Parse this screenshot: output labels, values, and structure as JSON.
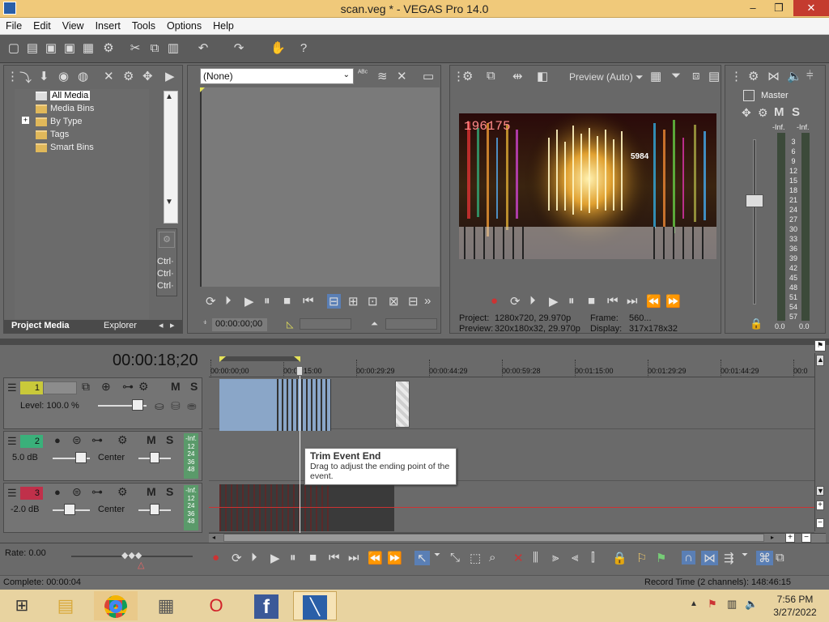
{
  "window": {
    "title": "scan.veg * - VEGAS Pro 14.0",
    "min": "‒",
    "max": "❐",
    "close": "✕"
  },
  "menu": [
    "File",
    "Edit",
    "View",
    "Insert",
    "Tools",
    "Options",
    "Help"
  ],
  "media_panel": {
    "tree": [
      "All Media",
      "Media Bins",
      "By Type",
      "Tags",
      "Smart Bins"
    ],
    "expand": "+",
    "ctrl": [
      "Ctrl·",
      "Ctrl·",
      "Ctrl·"
    ],
    "tabs": {
      "active": "Project Media",
      "other": "Explorer"
    }
  },
  "trimmer": {
    "dropdown": "(None)",
    "timecode": "00:00:00;00"
  },
  "preview": {
    "mode": "Preview (Auto)",
    "project_label": "Project:",
    "project_value": "1280x720, 29.970p",
    "preview_label": "Preview:",
    "preview_value": "320x180x32, 29.970p",
    "frame_label": "Frame:",
    "frame_value": "560...",
    "display_label": "Display:",
    "display_value": "317x178x32",
    "video_text_left": "196175",
    "video_text_num": "5984"
  },
  "master": {
    "label": "Master",
    "m": "M",
    "s": "S",
    "inf": [
      "-Inf.",
      "-Inf."
    ],
    "scale": [
      "3",
      "6",
      "9",
      "12",
      "15",
      "18",
      "21",
      "24",
      "27",
      "30",
      "33",
      "36",
      "39",
      "42",
      "45",
      "48",
      "51",
      "54",
      "57"
    ],
    "bottom": [
      "0.0",
      "0.0"
    ]
  },
  "timeline": {
    "timecode": "00:00:18;20",
    "ruler": [
      "00:00:00;00",
      "00:00:15:00",
      "00:00:29:29",
      "00:00:44:29",
      "00:00:59:28",
      "00:01:15:00",
      "00:01:29:29",
      "00:01:44:29",
      "00:0"
    ],
    "tracks": [
      {
        "num": "1",
        "level": "Level: 100.0 %",
        "color": "#c9c93a"
      },
      {
        "num": "2",
        "level": "5.0 dB",
        "pan": "Center",
        "color": "#3ab07a",
        "meter": [
          "-Inf.",
          "12",
          "24",
          "36",
          "48"
        ]
      },
      {
        "num": "3",
        "level": "-2.0 dB",
        "pan": "Center",
        "color": "#c0304a",
        "meter": [
          "-Inf.",
          "12",
          "24",
          "36",
          "48"
        ]
      }
    ],
    "m": "M",
    "s": "S",
    "tooltip": {
      "title": "Trim Event End",
      "body": "Drag to adjust the ending point of the event."
    },
    "rate": "Rate: 0.00"
  },
  "status": {
    "complete": "Complete: 00:00:04",
    "record": "Record Time (2 channels): 148:46:15"
  },
  "taskbar": {
    "time": "7:56 PM",
    "date": "3/27/2022"
  },
  "colors": {
    "titlebar": "#f0c97a",
    "accent": "#2a5fa8"
  }
}
